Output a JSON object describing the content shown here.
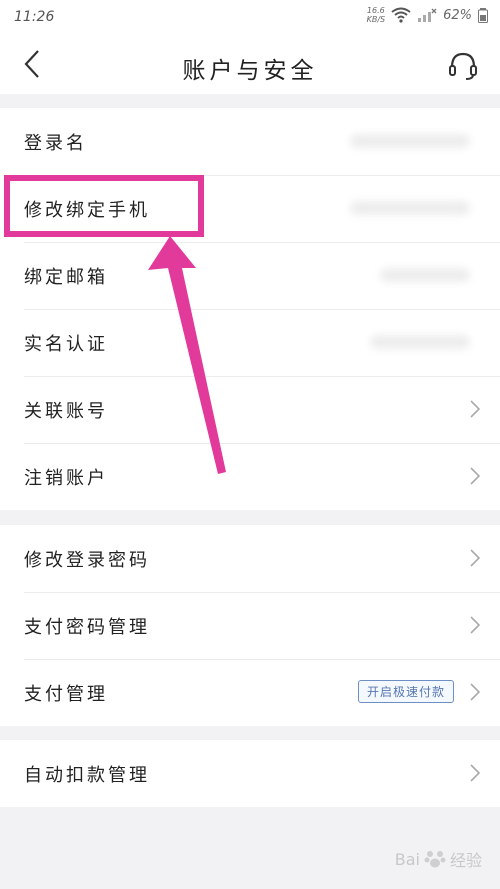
{
  "status": {
    "time": "11:26",
    "net_speed": "16.6",
    "net_unit": "KB/S",
    "battery": "62%"
  },
  "header": {
    "title": "账户与安全"
  },
  "groups": [
    {
      "items": [
        {
          "label": "登录名"
        },
        {
          "label": "修改绑定手机"
        },
        {
          "label": "绑定邮箱"
        },
        {
          "label": "实名认证"
        },
        {
          "label": "关联账号"
        },
        {
          "label": "注销账户"
        }
      ]
    },
    {
      "items": [
        {
          "label": "修改登录密码"
        },
        {
          "label": "支付密码管理"
        },
        {
          "label": "支付管理",
          "badge": "开启极速付款"
        }
      ]
    },
    {
      "items": [
        {
          "label": "自动扣款管理"
        }
      ]
    }
  ],
  "icons": {
    "back": "chevron-left-icon",
    "service": "headset-icon",
    "row_arrow": "chevron-right-icon"
  },
  "colors": {
    "highlight": "#e23a9b",
    "badge": "#5677b2"
  },
  "watermark": {
    "text": "Bai",
    "suffix": "经验"
  }
}
